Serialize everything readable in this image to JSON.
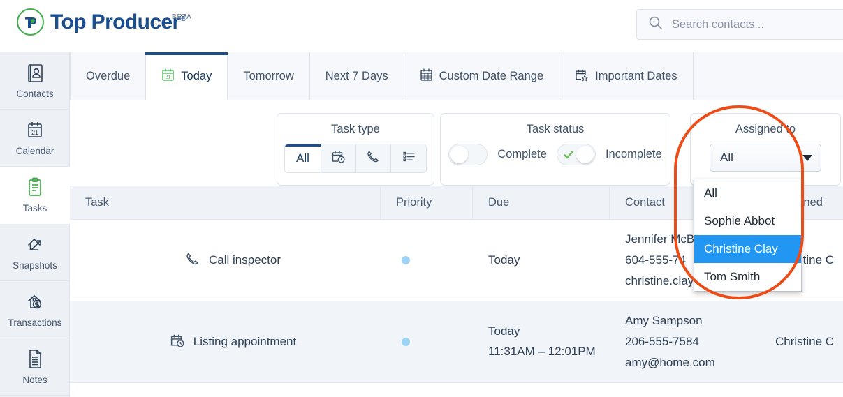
{
  "header": {
    "brand_name": "Top Producer",
    "brand_registered": "®",
    "beta_label": "BETA",
    "search_placeholder": "Search contacts...",
    "search_value": "",
    "logo_ring_color": "#3FAE49",
    "brand_color": "#1B4E8E"
  },
  "sidebar": {
    "items": [
      {
        "label": "Contacts",
        "icon": "contacts-icon",
        "active": false
      },
      {
        "label": "Calendar",
        "icon": "calendar-icon",
        "active": false
      },
      {
        "label": "Tasks",
        "icon": "tasks-icon",
        "active": true
      },
      {
        "label": "Snapshots",
        "icon": "snapshots-icon",
        "active": false
      },
      {
        "label": "Transactions",
        "icon": "transactions-icon",
        "active": false
      },
      {
        "label": "Notes",
        "icon": "notes-icon",
        "active": false
      }
    ]
  },
  "tabs": [
    {
      "label": "Overdue",
      "icon": null,
      "active": false
    },
    {
      "label": "Today",
      "icon": "calendar-21-icon",
      "active": true
    },
    {
      "label": "Tomorrow",
      "icon": null,
      "active": false
    },
    {
      "label": "Next 7 Days",
      "icon": null,
      "active": false
    },
    {
      "label": "Custom Date Range",
      "icon": "calendar-grid-icon",
      "active": false
    },
    {
      "label": "Important Dates",
      "icon": "calendar-star-icon",
      "active": false
    }
  ],
  "filters": {
    "task_type": {
      "title": "Task type",
      "options": [
        {
          "label": "All",
          "icon": null,
          "active": true
        },
        {
          "label": "",
          "icon": "calendar-clock-icon",
          "active": false
        },
        {
          "label": "",
          "icon": "phone-icon",
          "active": false
        },
        {
          "label": "",
          "icon": "list-icon",
          "active": false
        }
      ]
    },
    "task_status": {
      "title": "Task status",
      "complete": {
        "label": "Complete",
        "on": false
      },
      "incomplete": {
        "label": "Incomplete",
        "on": true,
        "check_color": "#6FBE5A"
      }
    },
    "assigned_to": {
      "title": "Assigned to",
      "selected": "All",
      "open": true,
      "options": [
        {
          "label": "All",
          "selected": false
        },
        {
          "label": "Sophie Abbot",
          "selected": false
        },
        {
          "label": "Christine Clay",
          "selected": true
        },
        {
          "label": "Tom Smith",
          "selected": false
        }
      ],
      "highlight_color": "#2196F3"
    }
  },
  "annotation": {
    "shape": "rounded-rect-outline",
    "color": "#EE4C16"
  },
  "table": {
    "columns": [
      "Task",
      "Priority",
      "Due",
      "Contact",
      "Assigned"
    ],
    "rows": [
      {
        "task": "Call inspector",
        "task_icon": "phone-icon",
        "priority_dot": "#9ED3F5",
        "due_lines": [
          "Today"
        ],
        "contact_lines": [
          "Jennifer McB",
          "604-555-74",
          "christine.clay@toppr..."
        ],
        "assigned": "Christine C"
      },
      {
        "task": "Listing appointment",
        "task_icon": "calendar-clock-icon",
        "priority_dot": "#9ED3F5",
        "due_lines": [
          "Today",
          "11:31AM – 12:01PM"
        ],
        "contact_lines": [
          "Amy Sampson",
          "206-555-7584",
          "amy@home.com"
        ],
        "assigned": "Christine C"
      }
    ]
  }
}
